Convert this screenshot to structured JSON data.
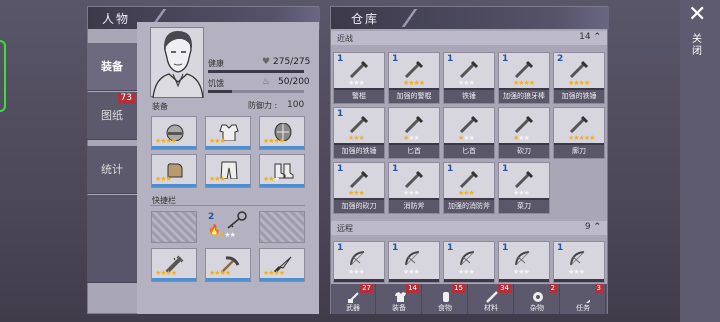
{
  "character": {
    "title": "人物",
    "tabs": [
      {
        "label": "装备",
        "active": true
      },
      {
        "label": "图纸",
        "badge": "73"
      },
      {
        "label": "统计"
      }
    ],
    "health_label": "健康",
    "health": "275/275",
    "hunger_label": "饥饿",
    "hunger": "50/200",
    "health_fill": 1.0,
    "hunger_fill": 0.25,
    "equipment_label": "装备",
    "defense_label": "防御力 :",
    "defense": "100",
    "quick_label": "快捷栏",
    "equipment": [
      {
        "icon": "helmet-icon",
        "stars": 4
      },
      {
        "icon": "armor-icon",
        "stars": 3
      },
      {
        "icon": "shield-icon",
        "stars": 4
      },
      {
        "icon": "gloves-icon",
        "stars": 3
      },
      {
        "icon": "pants-icon",
        "stars": 3
      },
      {
        "icon": "boots-icon",
        "stars": 2
      }
    ],
    "quickbar_top": [
      {
        "locked": true
      },
      {
        "icon": "key-icon",
        "count": "2",
        "stars": 1,
        "flame": true
      },
      {
        "locked": true
      }
    ],
    "quickbar_bottom": [
      {
        "icon": "spiked-bat-icon",
        "stars": 4
      },
      {
        "icon": "pickaxe-icon",
        "stars": 4
      },
      {
        "icon": "knife-icon",
        "stars": 4
      }
    ]
  },
  "warehouse": {
    "title": "仓库",
    "melee_label": "近战",
    "melee_count": "14",
    "ranged_label": "远程",
    "ranged_count": "9",
    "melee": [
      {
        "count": "1",
        "name": "警棍",
        "stars": 0
      },
      {
        "count": "1",
        "name": "加强的警棍",
        "stars": 4
      },
      {
        "count": "1",
        "name": "铁锤",
        "stars": 0
      },
      {
        "count": "1",
        "name": "加强的狼牙棒",
        "stars": 4
      },
      {
        "count": "2",
        "name": "加强的铁锤",
        "stars": 4
      },
      {
        "count": "1",
        "name": "加强的铁锤",
        "stars": 3
      },
      {
        "count": "",
        "name": "匕首",
        "stars": 1
      },
      {
        "count": "",
        "name": "匕首",
        "stars": 1
      },
      {
        "count": "",
        "name": "砍刀",
        "stars": 1
      },
      {
        "count": "",
        "name": "廓刀",
        "stars": 5
      },
      {
        "count": "1",
        "name": "加强的砍刀",
        "stars": 3
      },
      {
        "count": "1",
        "name": "消防斧",
        "stars": 0
      },
      {
        "count": "1",
        "name": "加强的消防斧",
        "stars": 3
      },
      {
        "count": "1",
        "name": "菜刀",
        "stars": 0
      }
    ],
    "ranged": [
      {
        "count": "1",
        "stars": 0
      },
      {
        "count": "1",
        "stars": 0
      },
      {
        "count": "1",
        "stars": 0
      },
      {
        "count": "1",
        "stars": 0
      },
      {
        "count": "1",
        "stars": 0
      }
    ],
    "bottom_tabs": [
      {
        "label": "武器",
        "count": "27",
        "icon": "weapon-icon"
      },
      {
        "label": "装备",
        "count": "14",
        "icon": "shirt-icon"
      },
      {
        "label": "食物",
        "count": "15",
        "icon": "food-icon"
      },
      {
        "label": "材料",
        "count": "34",
        "icon": "material-icon"
      },
      {
        "label": "杂物",
        "count": "2",
        "icon": "coin-icon"
      },
      {
        "label": "任务",
        "count": "3",
        "icon": "key-icon"
      }
    ]
  },
  "close": {
    "label": "关闭",
    "icon": "close-icon"
  },
  "colors": {
    "star": "#f0b020",
    "blue_bar": "#4f8fd0",
    "badge": "#b0313a"
  }
}
